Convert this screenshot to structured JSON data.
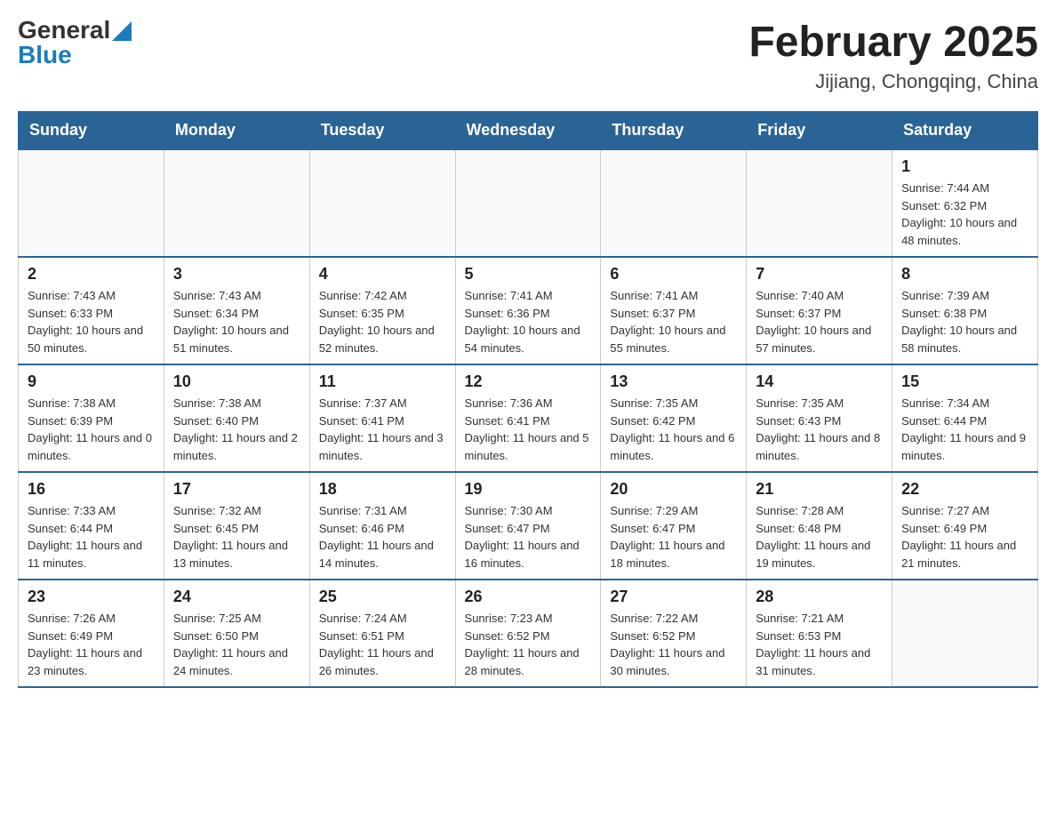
{
  "header": {
    "logo_general": "General",
    "logo_blue": "Blue",
    "month_title": "February 2025",
    "location": "Jijiang, Chongqing, China"
  },
  "days_of_week": [
    "Sunday",
    "Monday",
    "Tuesday",
    "Wednesday",
    "Thursday",
    "Friday",
    "Saturday"
  ],
  "weeks": [
    [
      {
        "day": "",
        "info": ""
      },
      {
        "day": "",
        "info": ""
      },
      {
        "day": "",
        "info": ""
      },
      {
        "day": "",
        "info": ""
      },
      {
        "day": "",
        "info": ""
      },
      {
        "day": "",
        "info": ""
      },
      {
        "day": "1",
        "info": "Sunrise: 7:44 AM\nSunset: 6:32 PM\nDaylight: 10 hours and 48 minutes."
      }
    ],
    [
      {
        "day": "2",
        "info": "Sunrise: 7:43 AM\nSunset: 6:33 PM\nDaylight: 10 hours and 50 minutes."
      },
      {
        "day": "3",
        "info": "Sunrise: 7:43 AM\nSunset: 6:34 PM\nDaylight: 10 hours and 51 minutes."
      },
      {
        "day": "4",
        "info": "Sunrise: 7:42 AM\nSunset: 6:35 PM\nDaylight: 10 hours and 52 minutes."
      },
      {
        "day": "5",
        "info": "Sunrise: 7:41 AM\nSunset: 6:36 PM\nDaylight: 10 hours and 54 minutes."
      },
      {
        "day": "6",
        "info": "Sunrise: 7:41 AM\nSunset: 6:37 PM\nDaylight: 10 hours and 55 minutes."
      },
      {
        "day": "7",
        "info": "Sunrise: 7:40 AM\nSunset: 6:37 PM\nDaylight: 10 hours and 57 minutes."
      },
      {
        "day": "8",
        "info": "Sunrise: 7:39 AM\nSunset: 6:38 PM\nDaylight: 10 hours and 58 minutes."
      }
    ],
    [
      {
        "day": "9",
        "info": "Sunrise: 7:38 AM\nSunset: 6:39 PM\nDaylight: 11 hours and 0 minutes."
      },
      {
        "day": "10",
        "info": "Sunrise: 7:38 AM\nSunset: 6:40 PM\nDaylight: 11 hours and 2 minutes."
      },
      {
        "day": "11",
        "info": "Sunrise: 7:37 AM\nSunset: 6:41 PM\nDaylight: 11 hours and 3 minutes."
      },
      {
        "day": "12",
        "info": "Sunrise: 7:36 AM\nSunset: 6:41 PM\nDaylight: 11 hours and 5 minutes."
      },
      {
        "day": "13",
        "info": "Sunrise: 7:35 AM\nSunset: 6:42 PM\nDaylight: 11 hours and 6 minutes."
      },
      {
        "day": "14",
        "info": "Sunrise: 7:35 AM\nSunset: 6:43 PM\nDaylight: 11 hours and 8 minutes."
      },
      {
        "day": "15",
        "info": "Sunrise: 7:34 AM\nSunset: 6:44 PM\nDaylight: 11 hours and 9 minutes."
      }
    ],
    [
      {
        "day": "16",
        "info": "Sunrise: 7:33 AM\nSunset: 6:44 PM\nDaylight: 11 hours and 11 minutes."
      },
      {
        "day": "17",
        "info": "Sunrise: 7:32 AM\nSunset: 6:45 PM\nDaylight: 11 hours and 13 minutes."
      },
      {
        "day": "18",
        "info": "Sunrise: 7:31 AM\nSunset: 6:46 PM\nDaylight: 11 hours and 14 minutes."
      },
      {
        "day": "19",
        "info": "Sunrise: 7:30 AM\nSunset: 6:47 PM\nDaylight: 11 hours and 16 minutes."
      },
      {
        "day": "20",
        "info": "Sunrise: 7:29 AM\nSunset: 6:47 PM\nDaylight: 11 hours and 18 minutes."
      },
      {
        "day": "21",
        "info": "Sunrise: 7:28 AM\nSunset: 6:48 PM\nDaylight: 11 hours and 19 minutes."
      },
      {
        "day": "22",
        "info": "Sunrise: 7:27 AM\nSunset: 6:49 PM\nDaylight: 11 hours and 21 minutes."
      }
    ],
    [
      {
        "day": "23",
        "info": "Sunrise: 7:26 AM\nSunset: 6:49 PM\nDaylight: 11 hours and 23 minutes."
      },
      {
        "day": "24",
        "info": "Sunrise: 7:25 AM\nSunset: 6:50 PM\nDaylight: 11 hours and 24 minutes."
      },
      {
        "day": "25",
        "info": "Sunrise: 7:24 AM\nSunset: 6:51 PM\nDaylight: 11 hours and 26 minutes."
      },
      {
        "day": "26",
        "info": "Sunrise: 7:23 AM\nSunset: 6:52 PM\nDaylight: 11 hours and 28 minutes."
      },
      {
        "day": "27",
        "info": "Sunrise: 7:22 AM\nSunset: 6:52 PM\nDaylight: 11 hours and 30 minutes."
      },
      {
        "day": "28",
        "info": "Sunrise: 7:21 AM\nSunset: 6:53 PM\nDaylight: 11 hours and 31 minutes."
      },
      {
        "day": "",
        "info": ""
      }
    ]
  ]
}
